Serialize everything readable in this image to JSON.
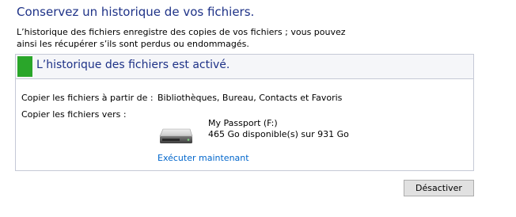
{
  "header": {
    "title": "Conservez un historique de vos fichiers.",
    "description": "L’historique des fichiers enregistre des copies de vos fichiers ; vous pouvez ainsi les récupérer s’ils sont perdus ou endommagés."
  },
  "status": {
    "text": "L’historique des fichiers est activé.",
    "indicator_color": "#2aa62a"
  },
  "details": {
    "copy_from_label": "Copier les fichiers à partir de :",
    "copy_from_value": "Bibliothèques, Bureau, Contacts et Favoris",
    "copy_to_label": "Copier les fichiers vers :",
    "drive": {
      "icon": "hard-drive-icon",
      "name": "My Passport (F:)",
      "space": "465 Go disponible(s) sur 931 Go"
    },
    "run_now_link": "Exécuter maintenant"
  },
  "footer": {
    "disable_button": "Désactiver"
  }
}
